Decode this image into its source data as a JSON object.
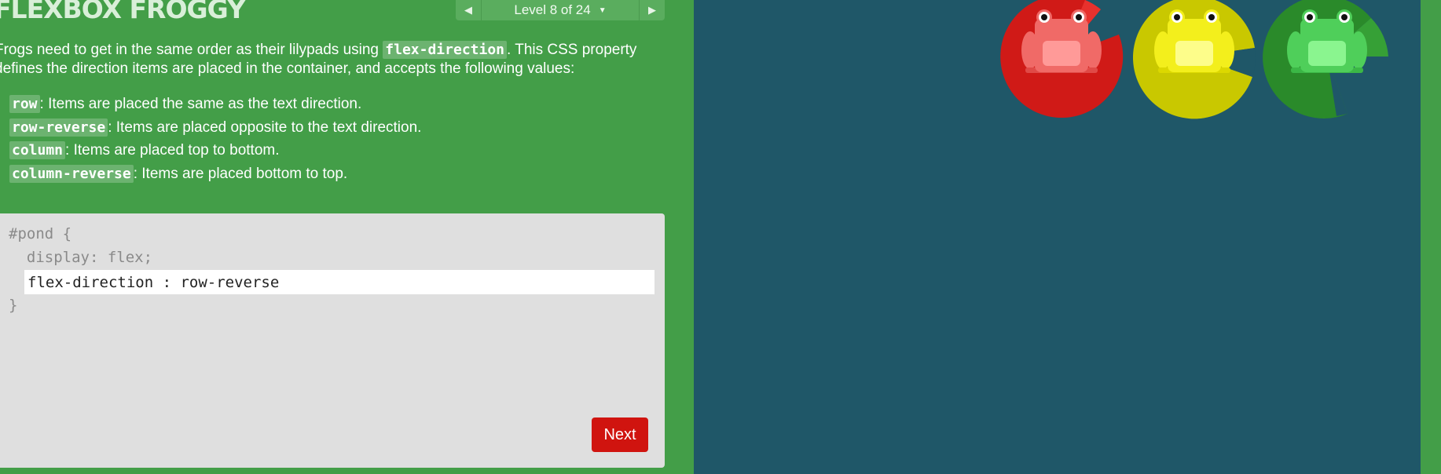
{
  "app": {
    "title": "FLEXBOX FROGGY"
  },
  "level_nav": {
    "label": "Level 8 of 24",
    "prev_icon": "triangle-left-icon",
    "next_icon": "triangle-right-icon",
    "caret_icon": "caret-down-icon"
  },
  "instructions": {
    "text_before": "Frogs need to get in the same order as their lilypads using ",
    "property": "flex-direction",
    "text_after": ". This CSS property defines the direction items are placed in the container, and accepts the following values:",
    "values": [
      {
        "code": "row",
        "desc": ": Items are placed the same as the text direction."
      },
      {
        "code": "row-reverse",
        "desc": ": Items are placed opposite to the text direction."
      },
      {
        "code": "column",
        "desc": ": Items are placed top to bottom."
      },
      {
        "code": "column-reverse",
        "desc": ": Items are placed bottom to top."
      }
    ]
  },
  "editor": {
    "line1": "#pond {",
    "line2": "  display: flex;",
    "input_value": "flex-direction : row-reverse",
    "line_close": "}",
    "next_label": "Next"
  },
  "pond": {
    "colors": {
      "water": "#1f5768",
      "sidebar": "#439e48",
      "red": "#d01a17",
      "yellow": "#c9c800",
      "green": "#2a8a2a"
    },
    "items": [
      {
        "color": "red",
        "frog": "frog-icon",
        "lilypad": "lilypad-icon"
      },
      {
        "color": "yellow",
        "frog": "frog-icon",
        "lilypad": "lilypad-icon"
      },
      {
        "color": "green",
        "frog": "frog-icon",
        "lilypad": "lilypad-icon"
      }
    ]
  }
}
